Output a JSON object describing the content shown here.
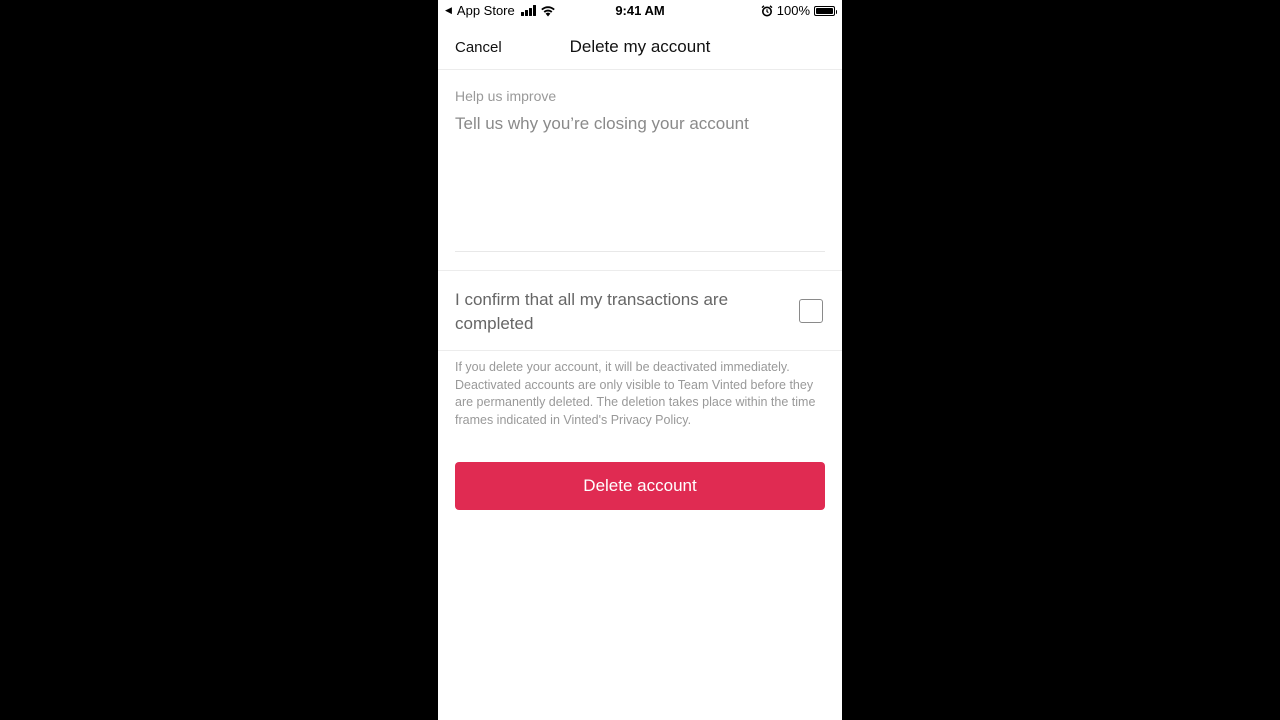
{
  "status_bar": {
    "back_app": "App Store",
    "time": "9:41 AM",
    "battery": "100%",
    "icons": [
      "back-arrow-icon",
      "signal-icon",
      "wifi-icon",
      "alarm-icon",
      "battery-icon"
    ]
  },
  "nav": {
    "cancel_label": "Cancel",
    "title": "Delete my account"
  },
  "form": {
    "reason_label": "Help us improve",
    "reason_placeholder": "Tell us why you’re closing your account",
    "reason_value": "",
    "confirm_label": "I confirm that all my transactions are completed",
    "confirm_checked": false,
    "notice": "If you delete your account, it will be deactivated immediately. Deactivated accounts are only visible to Team Vinted before they are permanently deleted. The deletion takes place within the time frames indicated in Vinted's Privacy Policy."
  },
  "actions": {
    "delete_label": "Delete account"
  },
  "colors": {
    "accent": "#e02b52",
    "background": "#ffffff",
    "outer": "#000000"
  }
}
